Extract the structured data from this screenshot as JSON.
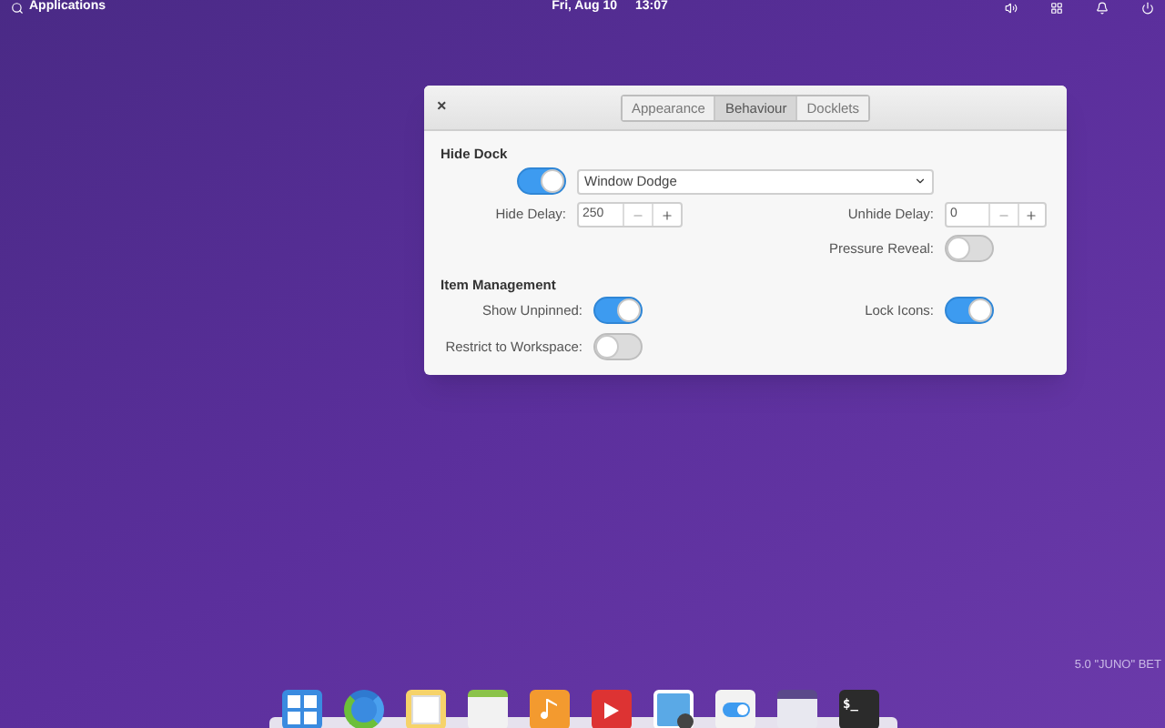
{
  "top_panel": {
    "applications": "Applications",
    "date": "Fri, Aug 10",
    "time": "13:07"
  },
  "dialog": {
    "close": "×",
    "tabs": [
      {
        "label": "Appearance",
        "selected": false
      },
      {
        "label": "Behaviour",
        "selected": true
      },
      {
        "label": "Docklets",
        "selected": false
      }
    ],
    "hide_dock": {
      "title": "Hide Dock",
      "enabled": true,
      "mode": "Window Dodge",
      "hide_delay": {
        "label": "Hide Delay:",
        "value": "250"
      },
      "unhide_delay": {
        "label": "Unhide Delay:",
        "value": "0"
      },
      "pressure_reveal": {
        "label": "Pressure Reveal:",
        "on": false
      }
    },
    "item_management": {
      "title": "Item Management",
      "show_unpinned": {
        "label": "Show Unpinned:",
        "on": true
      },
      "lock_icons": {
        "label": "Lock Icons:",
        "on": true
      },
      "restrict_to_workspace": {
        "label": "Restrict to Workspace:",
        "on": false
      }
    }
  },
  "version_label": "5.0 \"JUNO\" BET",
  "dock": [
    {
      "kind": "multitasking"
    },
    {
      "kind": "browser"
    },
    {
      "kind": "mail"
    },
    {
      "kind": "calendar"
    },
    {
      "kind": "music"
    },
    {
      "kind": "video"
    },
    {
      "kind": "photos"
    },
    {
      "kind": "settings"
    },
    {
      "kind": "store"
    },
    {
      "kind": "terminal",
      "glyph": "$_"
    }
  ]
}
